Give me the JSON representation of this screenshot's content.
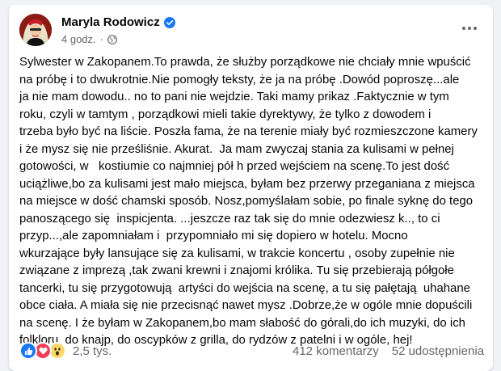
{
  "post": {
    "author": "Maryla Rodowicz",
    "time": "4 godz.",
    "separator": "·",
    "verified": true,
    "text_lines": [
      "Sylwester w Zakopanem.To prawda, że służby porządkowe nie chciały mnie wpuścić",
      "na próbę i to dwukrotnie.Nie pomogły teksty, że ja na próbę .Dowód poproszę...ale",
      "ja nie mam dowodu.. no to pani nie wejdzie. Taki mamy prikaz .Faktycznie w tym",
      "roku, czyli w tamtym , porządkowi mieli takie dyrektywy, że tylko z dowodem i",
      "trzeba było być na liście. Poszła fama, że na terenie miały być rozmieszczone kamery",
      "i że mysz się nie prześliśnie. Akurat.  Ja mam zwyczaj stania za kulisami w pełnej",
      "gotowości, w   kostiumie co najmniej pół h przed wejściem na scenę.To jest dość",
      "uciążliwe,bo za kulisami jest mało miejsca, byłam bez przerwy przeganiana z miejsca",
      "na miejsce w dość chamski sposób. Nosz,pomyślałam sobie, po finale syknę do tego",
      "panoszącego się  inspicjenta. ...jeszcze raz tak się do mnie odezwiesz k.., to ci",
      "przyp...,ale zapomniałam i  przypomniało mi się dopiero w hotelu. Mocno",
      "wkurzające były lansujące się za kulisami, w trakcie koncertu , osoby zupełnie nie",
      "związane z imprezą ,tak zwani krewni i znajomi królika. Tu się przebierają półgołe",
      "tancerki, tu się przygotowują  artyści do wejścia na scenę, a tu się pałętają  uhahane",
      "obce ciała. A miała się nie przecisnąć nawet mysz .Dobrze,że w ogóle mnie dopuścili",
      "na scenę. I że byłam w Zakopanem,bo mam słabość do górali,do ich muzyki, do ich",
      "folkloru, do knajp, do oscypków z grilla, do rydzów z patelni i w ogóle, hej!"
    ]
  },
  "footer": {
    "reaction_count": "2,5 tys.",
    "comments": "412 komentarzy",
    "shares": "52 udostępnienia",
    "reactions": [
      "like-icon",
      "love-icon",
      "wow-icon"
    ]
  },
  "colors": {
    "background": "#f0f2f5",
    "card": "#ffffff",
    "text": "#050505",
    "secondary": "#65676b",
    "verified": "#1877f2",
    "like": "#1877f2",
    "love": "#f33e58",
    "wow": "#fcd86b"
  }
}
